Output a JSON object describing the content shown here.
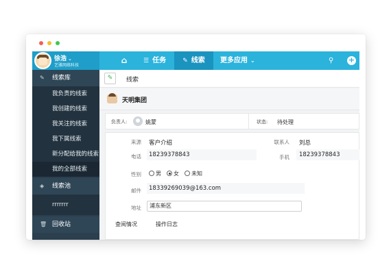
{
  "window": {
    "dots": [
      "red",
      "yellow",
      "green"
    ]
  },
  "user": {
    "name": "徐浩",
    "company": "艺雅网络科技"
  },
  "nav": {
    "home_icon": "home-icon",
    "items": [
      {
        "label": "任务",
        "icon": "list-icon"
      },
      {
        "label": "线索",
        "icon": "leads-icon",
        "active": true
      },
      {
        "label": "更多应用",
        "icon": "chevron-down-icon"
      }
    ],
    "search_icon": "search-icon",
    "plus_icon": "plus-icon",
    "plus_glyph": "+",
    "caret": "⌄"
  },
  "sidebar": {
    "groups": [
      {
        "label": "线索库",
        "icon": "leads-icon"
      },
      {
        "label": "线索池",
        "icon": "layers-icon"
      },
      {
        "label": "回收站",
        "icon": "trash-icon"
      }
    ],
    "items": [
      {
        "label": "我负责的线索"
      },
      {
        "label": "我创建的线索"
      },
      {
        "label": "我关注的线索"
      },
      {
        "label": "我下属线索"
      },
      {
        "label": "新分配给我的线索"
      },
      {
        "label": "我的全部线索",
        "active": true
      },
      {
        "label": "rrrrrrr"
      }
    ]
  },
  "breadcrumb": {
    "label": "线索"
  },
  "company": {
    "name": "天明集团"
  },
  "owner": {
    "label": "负责人:",
    "name": "姚蒙"
  },
  "status": {
    "label": "状态:",
    "value": "待处理"
  },
  "fields": {
    "source": {
      "label": "来源",
      "value": "客户介绍"
    },
    "contact": {
      "label": "联系人",
      "value": "刘总"
    },
    "phone": {
      "label": "电话",
      "value": "18239378843"
    },
    "mobile": {
      "label": "手机",
      "value": "18239378843"
    },
    "gender": {
      "label": "性别",
      "options": [
        "男",
        "女",
        "未知"
      ],
      "selected": "女"
    },
    "email": {
      "label": "邮件",
      "value": "18339269039@163.com"
    },
    "address": {
      "label": "地址",
      "value": "浦东新区"
    }
  },
  "tabs": {
    "view": "查阅情况",
    "log": "操作日志"
  },
  "colors": {
    "primary": "#2bb3dc",
    "sidebar": "#2b3f4e",
    "active_nav": "#1a93bf"
  }
}
